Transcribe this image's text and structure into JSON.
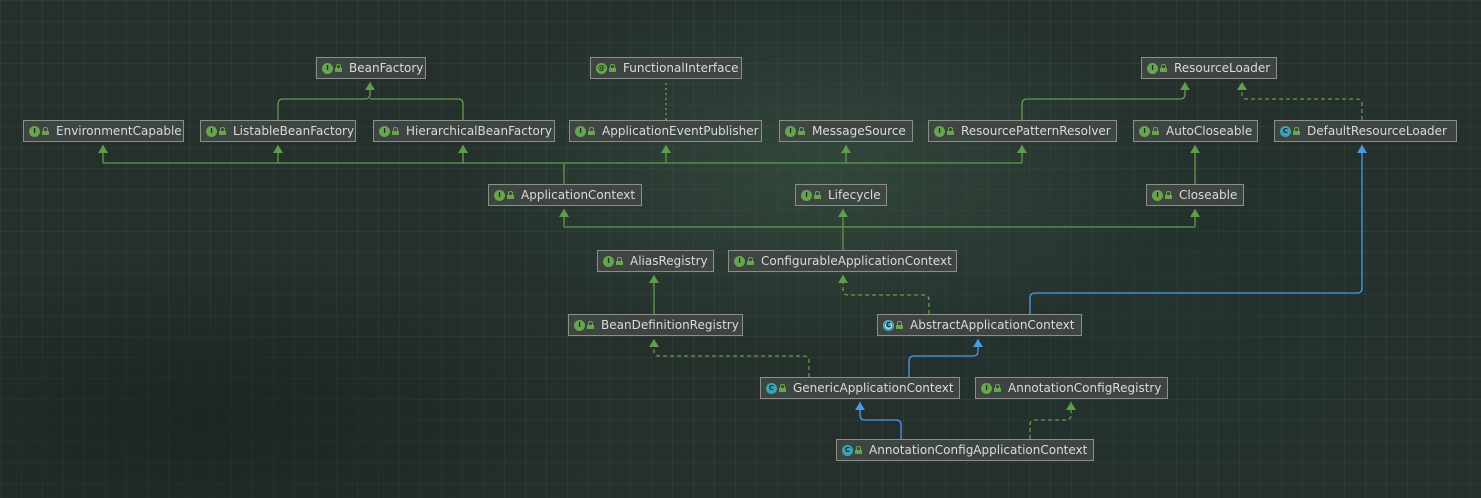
{
  "nodes": [
    {
      "id": "BeanFactory",
      "label": "BeanFactory",
      "kind": "interface",
      "icon": "interface-icon"
    },
    {
      "id": "FunctionalInterface",
      "label": "FunctionalInterface",
      "kind": "annotation",
      "icon": "annotation-icon"
    },
    {
      "id": "ResourceLoader",
      "label": "ResourceLoader",
      "kind": "interface",
      "icon": "interface-icon"
    },
    {
      "id": "EnvironmentCapable",
      "label": "EnvironmentCapable",
      "kind": "interface",
      "icon": "interface-icon"
    },
    {
      "id": "ListableBeanFactory",
      "label": "ListableBeanFactory",
      "kind": "interface",
      "icon": "interface-icon"
    },
    {
      "id": "HierarchicalBeanFactory",
      "label": "HierarchicalBeanFactory",
      "kind": "interface",
      "icon": "interface-icon"
    },
    {
      "id": "ApplicationEventPublisher",
      "label": "ApplicationEventPublisher",
      "kind": "interface",
      "icon": "interface-icon"
    },
    {
      "id": "MessageSource",
      "label": "MessageSource",
      "kind": "interface",
      "icon": "interface-icon"
    },
    {
      "id": "ResourcePatternResolver",
      "label": "ResourcePatternResolver",
      "kind": "interface",
      "icon": "interface-icon"
    },
    {
      "id": "AutoCloseable",
      "label": "AutoCloseable",
      "kind": "interface",
      "icon": "interface-icon"
    },
    {
      "id": "DefaultResourceLoader",
      "label": "DefaultResourceLoader",
      "kind": "class",
      "icon": "class-icon"
    },
    {
      "id": "ApplicationContext",
      "label": "ApplicationContext",
      "kind": "interface",
      "icon": "interface-icon"
    },
    {
      "id": "Lifecycle",
      "label": "Lifecycle",
      "kind": "interface",
      "icon": "interface-icon"
    },
    {
      "id": "Closeable",
      "label": "Closeable",
      "kind": "interface",
      "icon": "interface-icon"
    },
    {
      "id": "AliasRegistry",
      "label": "AliasRegistry",
      "kind": "interface",
      "icon": "interface-icon"
    },
    {
      "id": "ConfigurableApplicationContext",
      "label": "ConfigurableApplicationContext",
      "kind": "interface",
      "icon": "interface-icon"
    },
    {
      "id": "BeanDefinitionRegistry",
      "label": "BeanDefinitionRegistry",
      "kind": "interface",
      "icon": "interface-icon"
    },
    {
      "id": "AbstractApplicationContext",
      "label": "AbstractApplicationContext",
      "kind": "abstract-class",
      "icon": "abstract-class-icon"
    },
    {
      "id": "GenericApplicationContext",
      "label": "GenericApplicationContext",
      "kind": "class",
      "icon": "class-icon"
    },
    {
      "id": "AnnotationConfigRegistry",
      "label": "AnnotationConfigRegistry",
      "kind": "interface",
      "icon": "interface-icon"
    },
    {
      "id": "AnnotationConfigApplicationContext",
      "label": "AnnotationConfigApplicationContext",
      "kind": "class",
      "icon": "class-icon"
    }
  ],
  "edges": [
    {
      "from": "ListableBeanFactory",
      "to": "BeanFactory",
      "type": "extends"
    },
    {
      "from": "HierarchicalBeanFactory",
      "to": "BeanFactory",
      "type": "extends"
    },
    {
      "from": "ApplicationEventPublisher",
      "to": "FunctionalInterface",
      "type": "annotated"
    },
    {
      "from": "ResourcePatternResolver",
      "to": "ResourceLoader",
      "type": "extends"
    },
    {
      "from": "DefaultResourceLoader",
      "to": "ResourceLoader",
      "type": "implements"
    },
    {
      "from": "ApplicationContext",
      "to": "EnvironmentCapable",
      "type": "extends"
    },
    {
      "from": "ApplicationContext",
      "to": "ListableBeanFactory",
      "type": "extends"
    },
    {
      "from": "ApplicationContext",
      "to": "HierarchicalBeanFactory",
      "type": "extends"
    },
    {
      "from": "ApplicationContext",
      "to": "ApplicationEventPublisher",
      "type": "extends"
    },
    {
      "from": "ApplicationContext",
      "to": "MessageSource",
      "type": "extends"
    },
    {
      "from": "ApplicationContext",
      "to": "ResourcePatternResolver",
      "type": "extends"
    },
    {
      "from": "Closeable",
      "to": "AutoCloseable",
      "type": "extends"
    },
    {
      "from": "ConfigurableApplicationContext",
      "to": "ApplicationContext",
      "type": "extends"
    },
    {
      "from": "ConfigurableApplicationContext",
      "to": "Lifecycle",
      "type": "extends"
    },
    {
      "from": "ConfigurableApplicationContext",
      "to": "Closeable",
      "type": "extends"
    },
    {
      "from": "BeanDefinitionRegistry",
      "to": "AliasRegistry",
      "type": "extends"
    },
    {
      "from": "AbstractApplicationContext",
      "to": "ConfigurableApplicationContext",
      "type": "implements"
    },
    {
      "from": "AbstractApplicationContext",
      "to": "DefaultResourceLoader",
      "type": "class-extends"
    },
    {
      "from": "GenericApplicationContext",
      "to": "BeanDefinitionRegistry",
      "type": "implements"
    },
    {
      "from": "GenericApplicationContext",
      "to": "AbstractApplicationContext",
      "type": "class-extends"
    },
    {
      "from": "AnnotationConfigApplicationContext",
      "to": "GenericApplicationContext",
      "type": "class-extends"
    },
    {
      "from": "AnnotationConfigApplicationContext",
      "to": "AnnotationConfigRegistry",
      "type": "implements"
    }
  ],
  "colors": {
    "interface_edge": "#5f9e4b",
    "class_edge": "#4a9be6",
    "node_border": "#8a8f8c",
    "node_text": "#d9dcd9",
    "interface_badge": "#67a64f",
    "class_badge": "#3fa1b8"
  }
}
